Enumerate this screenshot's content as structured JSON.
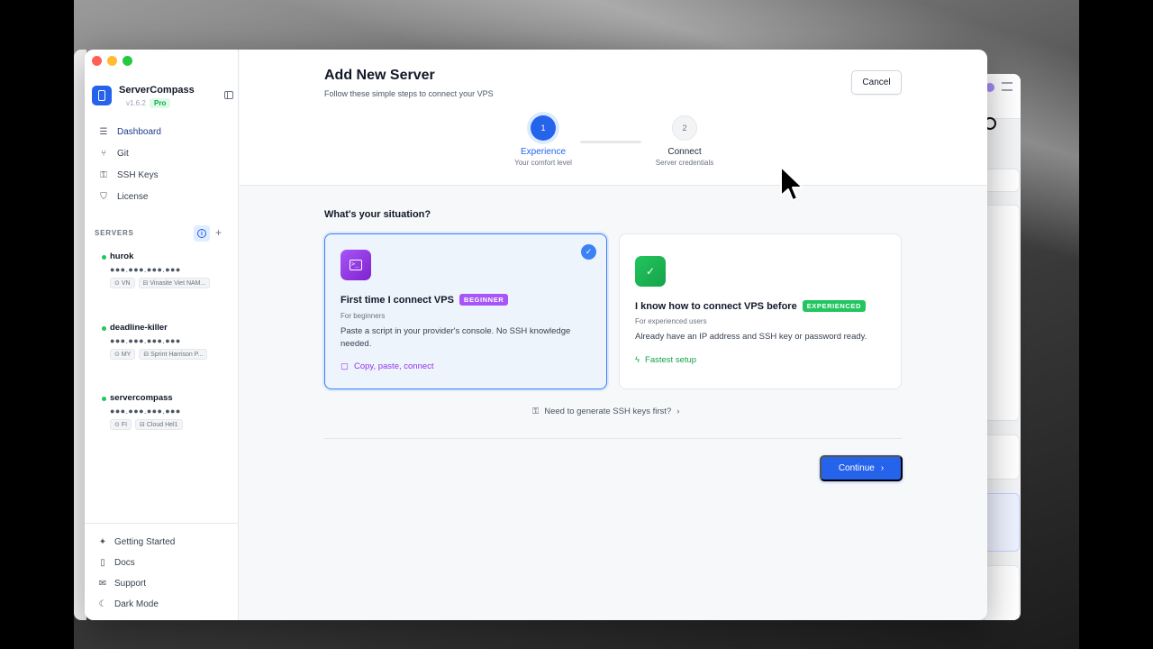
{
  "app": {
    "name": "ServerCompass",
    "version": "v1.6.2",
    "plan": "Pro"
  },
  "sidebar": {
    "nav": [
      {
        "label": "Dashboard",
        "icon": "database-icon"
      },
      {
        "label": "Git",
        "icon": "git-branch-icon"
      },
      {
        "label": "SSH Keys",
        "icon": "key-icon"
      },
      {
        "label": "License",
        "icon": "shield-icon"
      }
    ],
    "servers_label": "SERVERS",
    "servers": [
      {
        "name": "hurok",
        "ip": "●●●.●●●.●●●.●●●",
        "tags": [
          "VN",
          "Vinasite Viet NAM..."
        ]
      },
      {
        "name": "deadline-killer",
        "ip": "●●●.●●●.●●●.●●●",
        "tags": [
          "MY",
          "Sprint Harrison P..."
        ]
      },
      {
        "name": "servercompass",
        "ip": "●●●.●●●.●●●.●●●",
        "tags": [
          "FI",
          "Cloud Hel1"
        ]
      }
    ],
    "bottom": [
      {
        "label": "Getting Started",
        "icon": "sparkles-icon"
      },
      {
        "label": "Docs",
        "icon": "book-icon"
      },
      {
        "label": "Support",
        "icon": "mail-icon"
      },
      {
        "label": "Dark Mode",
        "icon": "moon-icon"
      }
    ]
  },
  "header": {
    "title": "Add New Server",
    "subtitle": "Follow these simple steps to connect your VPS",
    "cancel_label": "Cancel"
  },
  "steps": [
    {
      "number": "1",
      "label": "Experience",
      "sub": "Your comfort level"
    },
    {
      "number": "2",
      "label": "Connect",
      "sub": "Server credentials"
    }
  ],
  "content": {
    "question": "What's your situation?",
    "cards": [
      {
        "title": "First time I connect VPS",
        "badge": "BEGINNER",
        "sub": "For beginners",
        "desc": "Paste a script in your provider's console. No SSH knowledge needed.",
        "feature": "Copy, paste, connect"
      },
      {
        "title": "I know how to connect VPS before",
        "badge": "EXPERIENCED",
        "sub": "For experienced users",
        "desc": "Already have an IP address and SSH key or password ready.",
        "feature": "Fastest setup"
      }
    ],
    "ssh_link": "Need to generate SSH keys first?",
    "continue_label": "Continue"
  },
  "colors": {
    "accent": "#2563eb",
    "beginner": "#a855f7",
    "experienced": "#22c55e"
  }
}
